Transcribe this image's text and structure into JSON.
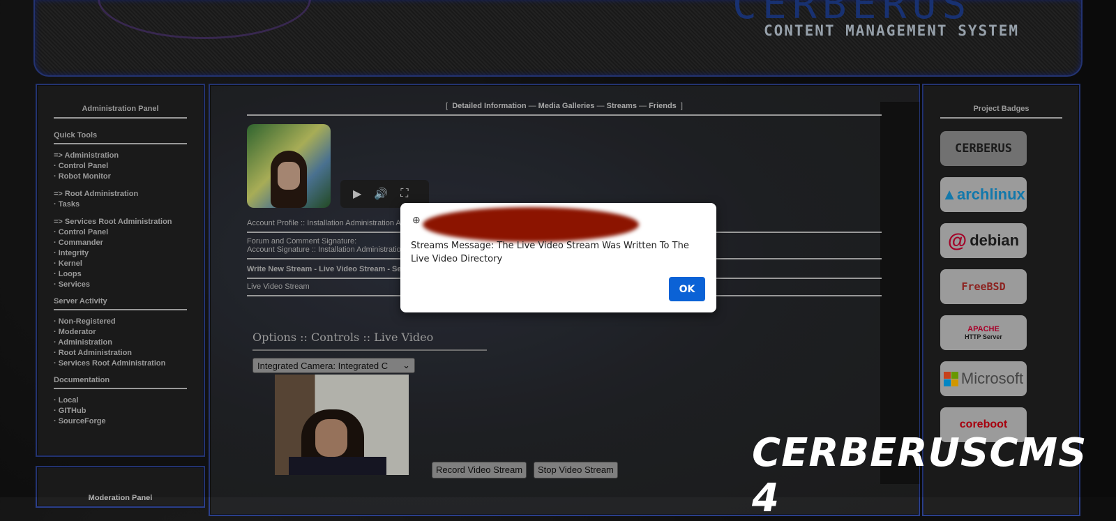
{
  "header": {
    "brand": "CERBERUS",
    "subtitle": "CONTENT MANAGEMENT SYSTEM"
  },
  "left_panel": {
    "title": "Administration Panel",
    "quick_tools_title": "Quick Tools",
    "group1": [
      "=> Administration",
      "· Control Panel",
      "· Robot Monitor"
    ],
    "group2": [
      "=> Root Administration",
      "· Tasks"
    ],
    "group3": [
      "=> Services Root Administration",
      "· Control Panel",
      "· Commander",
      "· Integrity",
      "· Kernel",
      "· Loops",
      "· Services"
    ],
    "server_activity_title": "Server Activity",
    "server_activity": [
      "· Non-Registered",
      "· Moderator",
      "· Administration",
      "· Root Administration",
      "· Services Root Administration"
    ],
    "documentation_title": "Documentation",
    "documentation": [
      "· Local",
      "· GITHub",
      "· SourceForge"
    ]
  },
  "moderation_panel": {
    "title": "Moderation Panel"
  },
  "main": {
    "nav": {
      "open_bracket": "[",
      "detailed_information": "Detailed Information",
      "sep": "—",
      "media_galleries": "Media Galleries",
      "streams": "Streams",
      "friends": "Friends",
      "close_bracket": "]"
    },
    "account_profile": "Account Profile :: Installation Administration A",
    "signature_label": "Forum and Comment Signature:",
    "signature_value": "Account Signature :: Installation Administration",
    "write_new_stream": "Write New Stream - Live Video Stream - Se",
    "live_video_stream": "Live Video Stream",
    "controls_title": "Options :: Controls :: Live Video",
    "camera_select_value": "Integrated Camera: Integrated C",
    "record_button": "Record Video Stream",
    "stop_button": "Stop Video Stream"
  },
  "right_panel": {
    "title": "Project Badges",
    "badges": [
      "CERBERUS",
      "archlinux",
      "debian",
      "FreeBSD",
      "APACHE",
      "HTTP Server",
      "Microsoft",
      "coreboot"
    ]
  },
  "dialog": {
    "message": "Streams Message: The Live Video Stream Was Written To The Live Video Directory",
    "ok_label": "OK"
  },
  "watermark": "CERBERUSCMS 4"
}
